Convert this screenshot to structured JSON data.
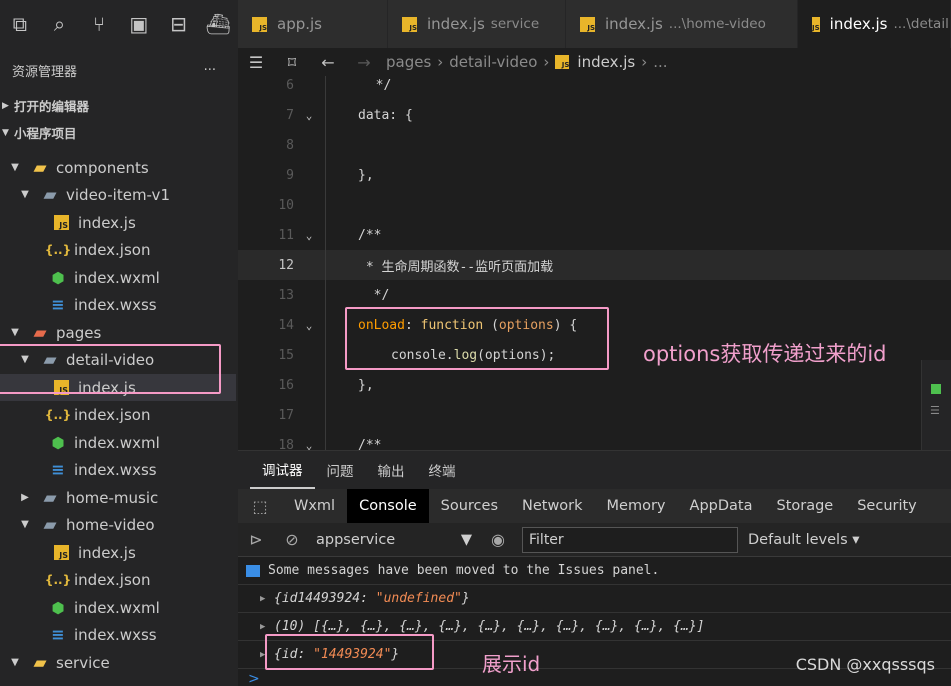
{
  "iconbar": {
    "icons": [
      "files-icon",
      "search-icon",
      "source-control-icon",
      "extensions-icon",
      "debug-icon",
      "docker-icon"
    ]
  },
  "explorer": {
    "title": "资源管理器",
    "more": "···",
    "sections": [
      "打开的编辑器",
      "小程序项目"
    ]
  },
  "tree": [
    {
      "label": "components",
      "icon": "folder-components-icon"
    },
    {
      "label": "video-item-v1",
      "icon": "folder-icon"
    },
    {
      "label": "index.js",
      "icon": "js-file-icon"
    },
    {
      "label": "index.json",
      "icon": "json-file-icon"
    },
    {
      "label": "index.wxml",
      "icon": "wxml-file-icon"
    },
    {
      "label": "index.wxss",
      "icon": "wxss-file-icon"
    },
    {
      "label": "pages",
      "icon": "folder-pages-icon"
    },
    {
      "label": "detail-video",
      "icon": "folder-icon"
    },
    {
      "label": "index.js",
      "icon": "js-file-icon"
    },
    {
      "label": "index.json",
      "icon": "json-file-icon"
    },
    {
      "label": "index.wxml",
      "icon": "wxml-file-icon"
    },
    {
      "label": "index.wxss",
      "icon": "wxss-file-icon"
    },
    {
      "label": "home-music",
      "icon": "folder-icon"
    },
    {
      "label": "home-video",
      "icon": "folder-icon"
    },
    {
      "label": "index.js",
      "icon": "js-file-icon"
    },
    {
      "label": "index.json",
      "icon": "json-file-icon"
    },
    {
      "label": "index.wxml",
      "icon": "wxml-file-icon"
    },
    {
      "label": "index.wxss",
      "icon": "wxss-file-icon"
    },
    {
      "label": "service",
      "icon": "folder-service-icon"
    }
  ],
  "tabs": [
    {
      "label": "app.js",
      "hint": ""
    },
    {
      "label": "index.js",
      "hint": "service"
    },
    {
      "label": "index.js",
      "hint": "...\\home-video"
    },
    {
      "label": "index.js",
      "hint": "...\\detail"
    }
  ],
  "breadcrumb": {
    "parts": [
      "pages",
      "detail-video",
      "index.js",
      "..."
    ]
  },
  "editor": {
    "lines": [
      {
        "n": "6",
        "code": "  */"
      },
      {
        "n": "7",
        "code": "data: {"
      },
      {
        "n": "8",
        "code": ""
      },
      {
        "n": "9",
        "code": "},"
      },
      {
        "n": "10",
        "code": ""
      },
      {
        "n": "11",
        "code": "/**"
      },
      {
        "n": "12",
        "code": " * 生命周期函数--监听页面加载"
      },
      {
        "n": "13",
        "code": "  */"
      },
      {
        "n": "14",
        "code_a": "onLoad",
        "code_b": ": ",
        "code_c": "function",
        "code_d": " (",
        "code_e": "options",
        "code_f": ") {"
      },
      {
        "n": "15",
        "code_a": "console.",
        "code_b": "log",
        "code_c": "(options);"
      },
      {
        "n": "16",
        "code": "},"
      },
      {
        "n": "17",
        "code": ""
      },
      {
        "n": "18",
        "code": "/**"
      }
    ]
  },
  "annotations": {
    "options_note": "options获取传递过来的id",
    "show_id_note": "展示id"
  },
  "debug": {
    "tabs": [
      "调试器",
      "问题",
      "输出",
      "终端"
    ],
    "devtools_tabs": [
      "Wxml",
      "Console",
      "Sources",
      "Network",
      "Memory",
      "AppData",
      "Storage",
      "Security"
    ],
    "context": "appservice",
    "filter_placeholder": "Filter",
    "levels": "Default levels",
    "messages": [
      {
        "type": "info",
        "text": "Some messages have been moved to the Issues panel."
      },
      {
        "type": "obj",
        "key": "{id14493924: ",
        "val": "\"undefined\"",
        "end": "}"
      },
      {
        "type": "arr",
        "text": "(10) [{…}, {…}, {…}, {…}, {…}, {…}, {…}, {…}, {…}, {…}]"
      },
      {
        "type": "obj",
        "key": "{id: ",
        "val": "\"14493924\"",
        "end": "}"
      }
    ],
    "prompt": ">"
  },
  "watermark": "CSDN @xxqsssqs"
}
